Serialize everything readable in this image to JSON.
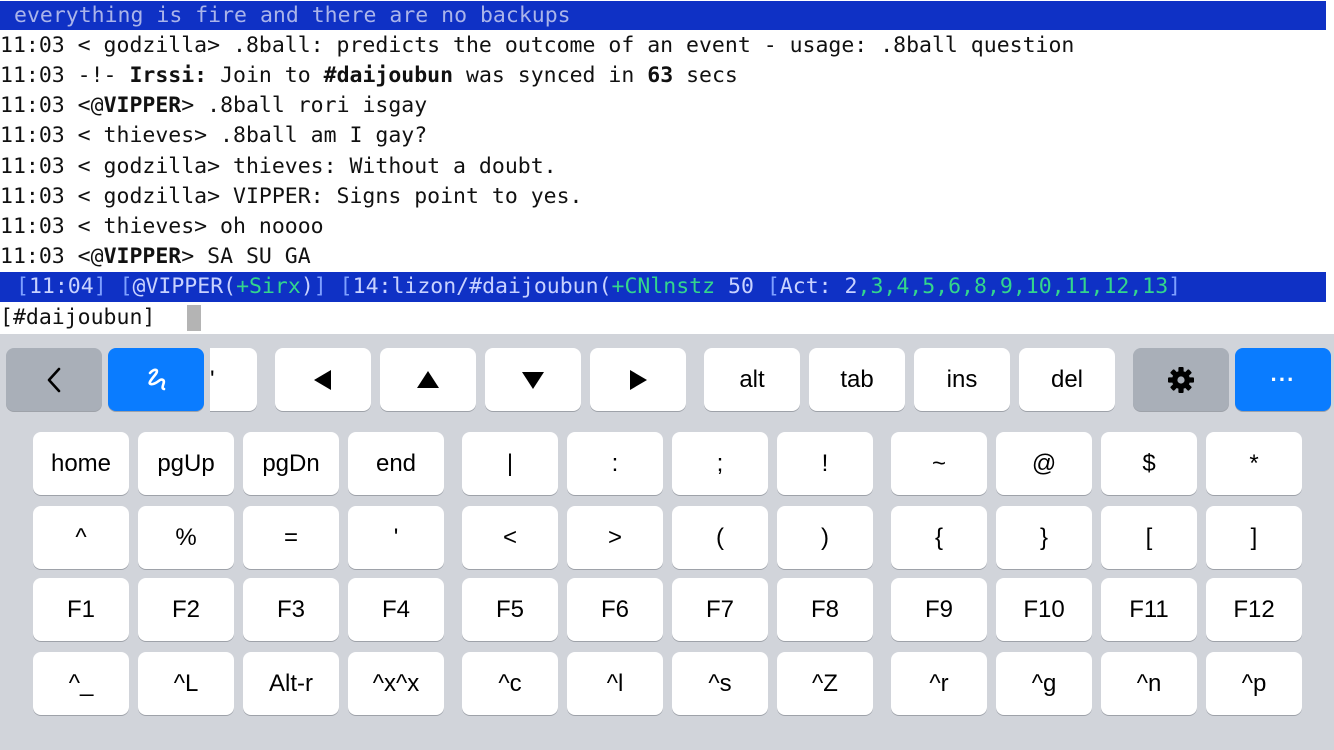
{
  "terminal": {
    "topic": "everything is fire and there are no backups",
    "lines": [
      [
        "11:03 < godzilla> .8ball: predicts the outcome of an event - usage: .8ball question"
      ],
      [
        "11:03 -!- ",
        "Irssi:",
        " Join to ",
        "#daijoubun",
        " was synced in ",
        "63",
        " secs"
      ],
      [
        "11:03 <@",
        "VIPPER",
        "> .8ball rori isgay"
      ],
      [
        "11:03 < thieves> .8ball am I gay?"
      ],
      [
        "11:03 < godzilla> thieves: Without a doubt."
      ],
      [
        "11:03 < godzilla> VIPPER: Signs point to yes."
      ],
      [
        "11:03 < thieves> oh noooo"
      ],
      [
        "11:03 <@",
        "VIPPER",
        "> SA SU GA"
      ]
    ],
    "status": {
      "time_open": "[",
      "time": "11:04",
      "time_close": "] ",
      "nick_open": "[",
      "nick": "@VIPPER(",
      "nick_mode": "+Sirx",
      "nick_close": ")] ",
      "chan_open": "[",
      "chan": "14:lizon/#daijoubun(",
      "chan_mode": "+CNlnstz",
      "chan_users": " 50 ",
      "act_open": "[",
      "act_label": "Act: ",
      "act_first": "2",
      "act_rest": ",3,4,5,6,8,9,10,11,12,13",
      "act_close": "]"
    },
    "prompt": "[#daijoubun]"
  },
  "keyboard": {
    "toolbar": {
      "back_icon": "chevron-left-icon",
      "scribble_icon": "scribble-icon",
      "partial_key": "'",
      "arrows": [
        "left-arrow-icon",
        "up-arrow-icon",
        "down-arrow-icon",
        "right-arrow-icon"
      ],
      "alt": "alt",
      "tab": "tab",
      "ins": "ins",
      "del": "del",
      "settings_icon": "gear-icon",
      "more": "···"
    },
    "rows": [
      [
        "home",
        "pgUp",
        "pgDn",
        "end",
        "|",
        ":",
        ";",
        "!",
        "~",
        "@",
        "$",
        "*"
      ],
      [
        "^",
        "%",
        "=",
        "'",
        "<",
        ">",
        "(",
        ")",
        "{",
        "}",
        "[",
        "]"
      ],
      [
        "F1",
        "F2",
        "F3",
        "F4",
        "F5",
        "F6",
        "F7",
        "F8",
        "F9",
        "F10",
        "F11",
        "F12"
      ],
      [
        "^_",
        "^L",
        "Alt-r",
        "^x^x",
        "^c",
        "^l",
        "^s",
        "^Z",
        "^r",
        "^g",
        "^n",
        "^p"
      ]
    ]
  },
  "colors": {
    "terminal_bar": "#0f31c5",
    "accent_blue": "#0a7cff",
    "status_green": "#33d68c"
  }
}
